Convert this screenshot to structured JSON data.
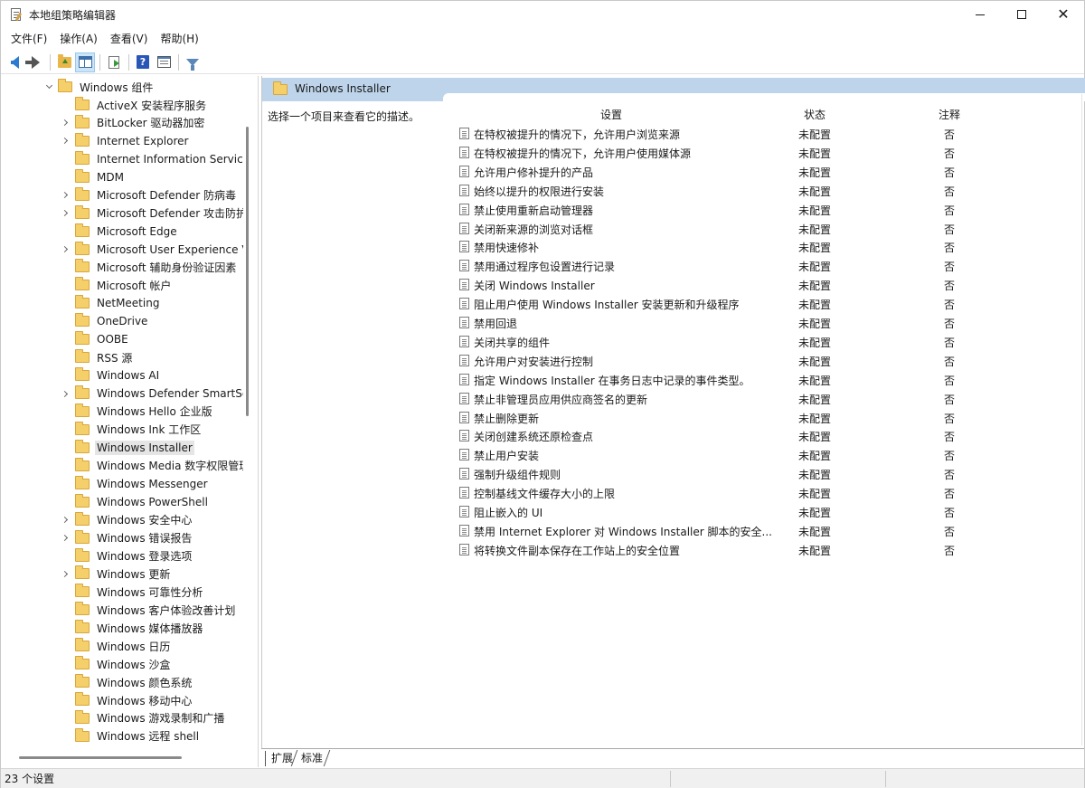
{
  "window": {
    "title": "本地组策略编辑器"
  },
  "menu": [
    "文件(F)",
    "操作(A)",
    "查看(V)",
    "帮助(H)"
  ],
  "toolbar": {
    "buttons": [
      "back-icon",
      "forward-icon",
      "up-folder-icon",
      "show-hide-tree-icon",
      "export-list-icon",
      "help-icon",
      "properties-icon",
      "filter-icon"
    ],
    "help_glyph": "?"
  },
  "tree": {
    "root": {
      "label": "Windows 组件",
      "expanded": true
    },
    "items": [
      {
        "label": "ActiveX 安装程序服务",
        "expandable": false
      },
      {
        "label": "BitLocker 驱动器加密",
        "expandable": true
      },
      {
        "label": "Internet Explorer",
        "expandable": true
      },
      {
        "label": "Internet Information Service",
        "expandable": false
      },
      {
        "label": "MDM",
        "expandable": false
      },
      {
        "label": "Microsoft Defender 防病毒",
        "expandable": true
      },
      {
        "label": "Microsoft Defender 攻击防护",
        "expandable": true
      },
      {
        "label": "Microsoft Edge",
        "expandable": false
      },
      {
        "label": "Microsoft User Experience V",
        "expandable": true
      },
      {
        "label": "Microsoft 辅助身份验证因素",
        "expandable": false
      },
      {
        "label": "Microsoft 帐户",
        "expandable": false
      },
      {
        "label": "NetMeeting",
        "expandable": false
      },
      {
        "label": "OneDrive",
        "expandable": false
      },
      {
        "label": "OOBE",
        "expandable": false
      },
      {
        "label": "RSS 源",
        "expandable": false
      },
      {
        "label": "Windows AI",
        "expandable": false
      },
      {
        "label": "Windows Defender SmartSc",
        "expandable": true
      },
      {
        "label": "Windows Hello 企业版",
        "expandable": false
      },
      {
        "label": "Windows Ink 工作区",
        "expandable": false
      },
      {
        "label": "Windows Installer",
        "expandable": false,
        "selected": true
      },
      {
        "label": "Windows Media 数字权限管理",
        "expandable": false
      },
      {
        "label": "Windows Messenger",
        "expandable": false
      },
      {
        "label": "Windows PowerShell",
        "expandable": false
      },
      {
        "label": "Windows 安全中心",
        "expandable": true
      },
      {
        "label": "Windows 错误报告",
        "expandable": true
      },
      {
        "label": "Windows 登录选项",
        "expandable": false
      },
      {
        "label": "Windows 更新",
        "expandable": true
      },
      {
        "label": "Windows 可靠性分析",
        "expandable": false
      },
      {
        "label": "Windows 客户体验改善计划",
        "expandable": false
      },
      {
        "label": "Windows 媒体播放器",
        "expandable": false
      },
      {
        "label": "Windows 日历",
        "expandable": false
      },
      {
        "label": "Windows 沙盒",
        "expandable": false
      },
      {
        "label": "Windows 颜色系统",
        "expandable": false
      },
      {
        "label": "Windows 移动中心",
        "expandable": false
      },
      {
        "label": "Windows 游戏录制和广播",
        "expandable": false
      },
      {
        "label": "Windows 远程 shell",
        "expandable": false
      }
    ]
  },
  "details": {
    "header_title": "Windows Installer",
    "description": "选择一个项目来查看它的描述。",
    "columns": {
      "setting": "设置",
      "state": "状态",
      "note": "注释"
    },
    "policies": [
      {
        "name": "在特权被提升的情况下，允许用户浏览来源",
        "state": "未配置",
        "note": "否"
      },
      {
        "name": "在特权被提升的情况下，允许用户使用媒体源",
        "state": "未配置",
        "note": "否"
      },
      {
        "name": "允许用户修补提升的产品",
        "state": "未配置",
        "note": "否"
      },
      {
        "name": "始终以提升的权限进行安装",
        "state": "未配置",
        "note": "否"
      },
      {
        "name": "禁止使用重新启动管理器",
        "state": "未配置",
        "note": "否"
      },
      {
        "name": "关闭新来源的浏览对话框",
        "state": "未配置",
        "note": "否"
      },
      {
        "name": "禁用快速修补",
        "state": "未配置",
        "note": "否"
      },
      {
        "name": "禁用通过程序包设置进行记录",
        "state": "未配置",
        "note": "否"
      },
      {
        "name": "关闭 Windows Installer",
        "state": "未配置",
        "note": "否"
      },
      {
        "name": "阻止用户使用 Windows Installer 安装更新和升级程序",
        "state": "未配置",
        "note": "否"
      },
      {
        "name": "禁用回退",
        "state": "未配置",
        "note": "否"
      },
      {
        "name": "关闭共享的组件",
        "state": "未配置",
        "note": "否"
      },
      {
        "name": "允许用户对安装进行控制",
        "state": "未配置",
        "note": "否"
      },
      {
        "name": "指定 Windows Installer 在事务日志中记录的事件类型。",
        "state": "未配置",
        "note": "否"
      },
      {
        "name": "禁止非管理员应用供应商签名的更新",
        "state": "未配置",
        "note": "否"
      },
      {
        "name": "禁止删除更新",
        "state": "未配置",
        "note": "否"
      },
      {
        "name": "关闭创建系统还原检查点",
        "state": "未配置",
        "note": "否"
      },
      {
        "name": "禁止用户安装",
        "state": "未配置",
        "note": "否"
      },
      {
        "name": "强制升级组件规则",
        "state": "未配置",
        "note": "否"
      },
      {
        "name": "控制基线文件缓存大小的上限",
        "state": "未配置",
        "note": "否"
      },
      {
        "name": "阻止嵌入的 UI",
        "state": "未配置",
        "note": "否"
      },
      {
        "name": "禁用 Internet Explorer 对 Windows Installer 脚本的安全...",
        "state": "未配置",
        "note": "否"
      },
      {
        "name": "将转换文件副本保存在工作站上的安全位置",
        "state": "未配置",
        "note": "否"
      }
    ]
  },
  "bottom_tabs": [
    "扩展",
    "标准"
  ],
  "status": {
    "text": "23 个设置"
  },
  "colors": {
    "banner": "#bdd4ea",
    "selection": "#e5e5e5",
    "folder": "#f4cf6a"
  }
}
